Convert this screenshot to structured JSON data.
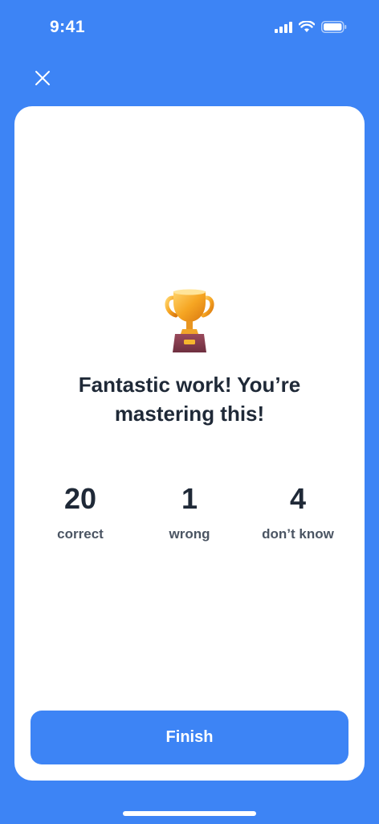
{
  "status_bar": {
    "time": "9:41"
  },
  "header": {
    "close_icon": "close-icon"
  },
  "result": {
    "trophy_icon": "trophy-icon",
    "headline_line1": "Fantastic work! You’re",
    "headline_line2": "mastering this!"
  },
  "stats": [
    {
      "value": "20",
      "label": "correct"
    },
    {
      "value": "1",
      "label": "wrong"
    },
    {
      "value": "4",
      "label": "don’t know"
    }
  ],
  "actions": {
    "finish_label": "Finish"
  },
  "colors": {
    "background": "#3d84f5",
    "card": "#ffffff",
    "text": "#1f2937",
    "muted_text": "#4b5563",
    "button": "#3d84f5"
  }
}
